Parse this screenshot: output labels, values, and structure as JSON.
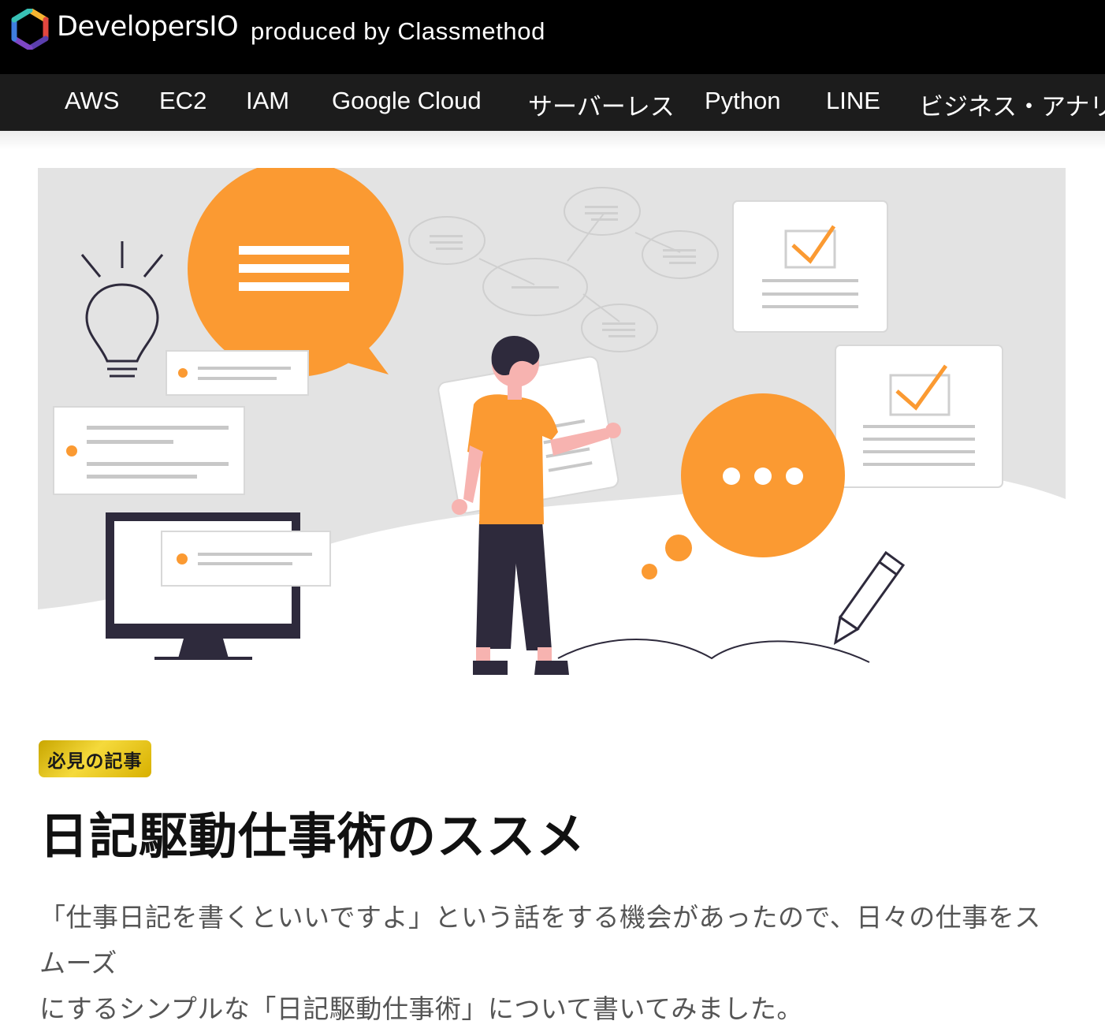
{
  "header": {
    "brand": "DevelopersIO",
    "tagline": "produced by Classmethod"
  },
  "nav": {
    "items": [
      {
        "label": "AWS"
      },
      {
        "label": "EC2"
      },
      {
        "label": "IAM"
      },
      {
        "label": "Google Cloud"
      },
      {
        "label": "サーバーレス"
      },
      {
        "label": "Python"
      },
      {
        "label": "LINE"
      },
      {
        "label": "ビジネス・アナリテ"
      }
    ]
  },
  "article": {
    "badge": "必見の記事",
    "title": "日記駆動仕事術のススメ",
    "lead_line1": "「仕事日記を書くといいですよ」という話をする機会があったので、日々の仕事をスムーズ",
    "lead_line2": "にするシンプルな「日記駆動仕事術」について書いてみました。"
  },
  "colors": {
    "header_bg": "#000000",
    "nav_bg": "#1c1c1c",
    "accent_orange": "#fb9a32",
    "badge_gold": "#e6c21a",
    "dark_navy": "#2e2a3c"
  },
  "hero": {
    "illustration": "person-with-speech-bubbles-and-checklists"
  }
}
